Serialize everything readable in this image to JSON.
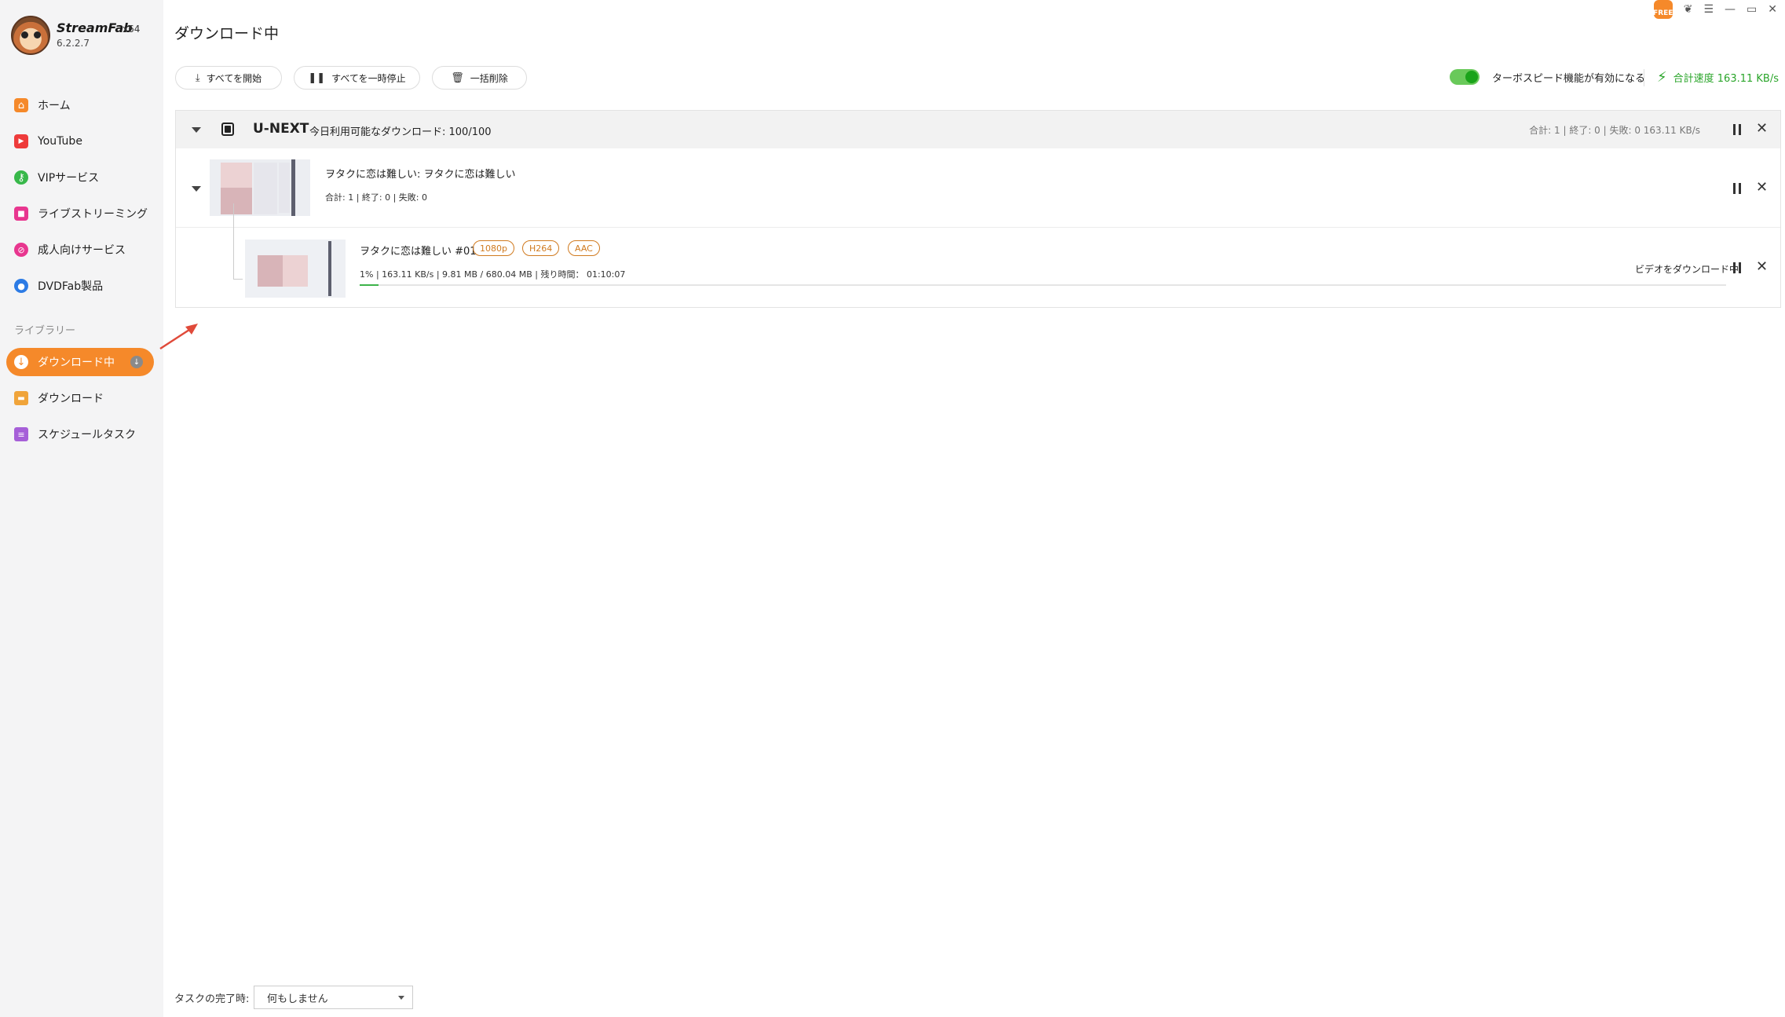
{
  "app": {
    "brand": "StreamFab",
    "arch": "x64",
    "version": "6.2.2.7"
  },
  "window_controls": {
    "free_label": "FREE",
    "shirt": "❦",
    "menu": "☰",
    "minimize": "—",
    "maximize": "▭",
    "close": "✕"
  },
  "sidebar": {
    "items": [
      {
        "label": "ホーム",
        "icon": "home-icon",
        "color": "#f5892a"
      },
      {
        "label": "YouTube",
        "icon": "youtube-icon",
        "color": "#ee3b3b"
      },
      {
        "label": "VIPサービス",
        "icon": "key-icon",
        "color": "#38b84a"
      },
      {
        "label": "ライブストリーミング",
        "icon": "camera-icon",
        "color": "#e8368f"
      },
      {
        "label": "成人向けサービス",
        "icon": "adult-block-icon",
        "color": "#e8368f"
      },
      {
        "label": "DVDFab製品",
        "icon": "dvdfab-icon",
        "color": "#2c7be5"
      }
    ],
    "library_label": "ライブラリー",
    "library_items": [
      {
        "label": "ダウンロード中",
        "icon": "download-icon",
        "active": true
      },
      {
        "label": "ダウンロード",
        "icon": "folder-icon",
        "color": "#f0a43a"
      },
      {
        "label": "スケジュールタスク",
        "icon": "schedule-icon",
        "color": "#a65fd8"
      }
    ]
  },
  "page_title": "ダウンロード中",
  "toolbar": {
    "start_all": "すべてを開始",
    "pause_all": "すべてを一時停止",
    "delete_all": "一括削除",
    "turbo_label": "ターボスピード機能が有効になる",
    "turbo_on": true,
    "total_speed": "合計速度 163.11 KB/s"
  },
  "group": {
    "service": "U-NEXT",
    "quota": "今日利用可能なダウンロード: 100/100",
    "stats": "合計: 1  |  終了: 0  |  失敗: 0     163.11 KB/s",
    "series": {
      "title": "ヲタクに恋は難しい: ヲタクに恋は難しい",
      "stats": "合計: 1  |   終了: 0  |   失敗: 0"
    },
    "episode": {
      "title": "ヲタクに恋は難しい #01",
      "tags": [
        "1080p",
        "H264",
        "AAC"
      ],
      "stats": "1%  |   163.11 KB/s  |   9.81 MB / 680.04 MB  |   残り時間： 01:10:07",
      "progress": 0.01,
      "status": "ビデオをダウンロード中"
    }
  },
  "footer": {
    "completion_label": "タスクの完了時:",
    "completion_value": "何もしません"
  },
  "accent_color": "#f5892a",
  "progress_color": "#3db34a"
}
